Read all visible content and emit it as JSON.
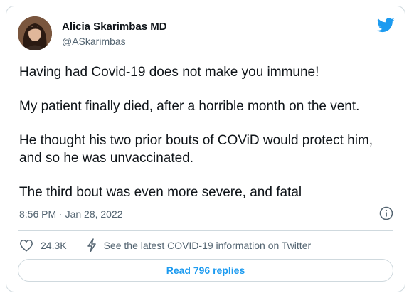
{
  "author": {
    "name": "Alicia Skarimbas MD",
    "handle": "@ASkarimbas",
    "avatar_icon": "profile-photo"
  },
  "brand": {
    "icon": "twitter-bird-icon",
    "color": "#1d9bf0"
  },
  "tweet": {
    "paragraphs": [
      "Having had Covid-19 does not make you immune!",
      "My patient finally died, after a horrible month on the vent.",
      "He thought his two prior bouts of COViD would protect him, and so he was unvaccinated.",
      "The third bout was even more severe, and fatal"
    ],
    "timestamp": "8:56 PM · Jan 28, 2022"
  },
  "actions": {
    "like_count": "24.3K",
    "info_link": "See the latest COVID-19 information on Twitter"
  },
  "replies_button": "Read 796 replies",
  "colors": {
    "text": "#0f1419",
    "secondary": "#536471",
    "border": "#cfd9de",
    "accent": "#1d9bf0"
  }
}
